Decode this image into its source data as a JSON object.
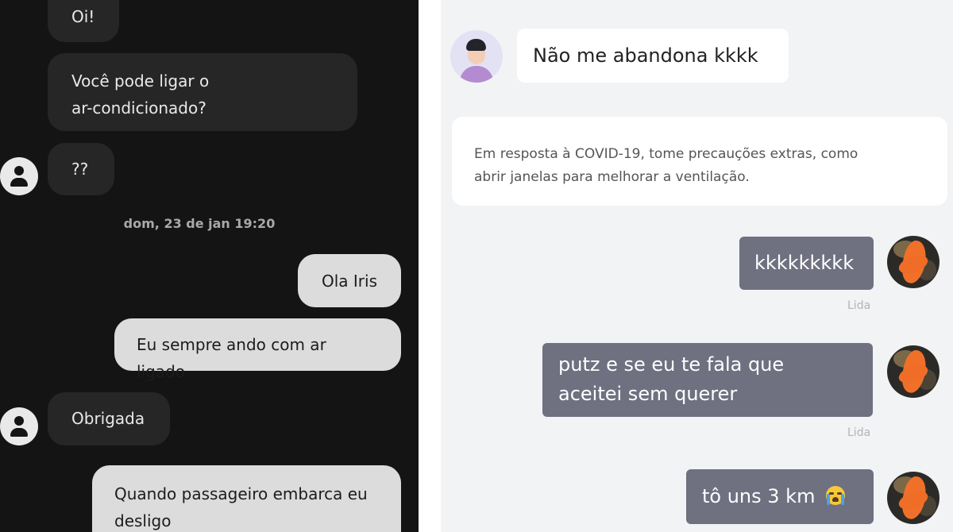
{
  "left_chat": {
    "messages": [
      {
        "side": "in",
        "text": "Oi!"
      },
      {
        "side": "in",
        "lines": [
          "Você pode ligar o",
          "ar-condicionado?"
        ]
      },
      {
        "side": "in",
        "text": "??"
      },
      {
        "side": "out",
        "text": "Ola Iris"
      },
      {
        "side": "out",
        "text": "Eu sempre ando com ar ligado"
      },
      {
        "side": "in",
        "text": "Obrigada"
      },
      {
        "side": "out",
        "lines": [
          "Quando passageiro embarca eu",
          "desligo"
        ]
      }
    ],
    "timestamp": "dom, 23 de jan 19:20",
    "avatar_icon": "user-icon"
  },
  "right_chat": {
    "top_message": "Não me abandona kkkk",
    "notice_lines": [
      "Em resposta à COVID-19, tome precauções extras, como",
      "abrir janelas para melhorar a ventilação."
    ],
    "messages": [
      {
        "lines": [
          "kkkkkkkkk"
        ],
        "status": "Lida"
      },
      {
        "lines": [
          "putz e se eu te fala que",
          "aceitei sem querer"
        ],
        "status": "Lida"
      },
      {
        "text": "tô uns 3 km",
        "emoji": "loudly-crying-face-icon"
      }
    ],
    "colors": {
      "bubble": "#6f7080",
      "background": "#f2f3f5",
      "dark_bg": "#141414"
    }
  }
}
